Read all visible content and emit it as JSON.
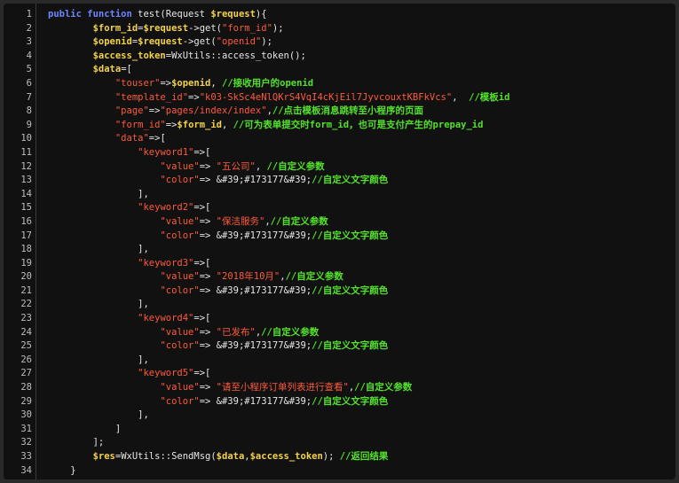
{
  "colors": {
    "background": "#111111",
    "keyword": "#6e86ff",
    "variable": "#f2d24b",
    "string": "#ff5a3c",
    "comment": "#54e12c",
    "default": "#e6e6e6",
    "line_number": "#bdbdbd"
  },
  "lines": [
    {
      "n": "1",
      "tokens": [
        {
          "t": "kw",
          "v": "public function"
        },
        {
          "t": "op",
          "v": " test(Request "
        },
        {
          "t": "var",
          "v": "$request"
        },
        {
          "t": "op",
          "v": "){"
        }
      ]
    },
    {
      "n": "2",
      "tokens": [
        {
          "t": "op",
          "v": "        "
        },
        {
          "t": "var",
          "v": "$form_id"
        },
        {
          "t": "op",
          "v": "="
        },
        {
          "t": "var",
          "v": "$request"
        },
        {
          "t": "op",
          "v": "->get("
        },
        {
          "t": "str",
          "v": "\"form_id\""
        },
        {
          "t": "op",
          "v": ");"
        }
      ]
    },
    {
      "n": "3",
      "tokens": [
        {
          "t": "op",
          "v": "        "
        },
        {
          "t": "var",
          "v": "$openid"
        },
        {
          "t": "op",
          "v": "="
        },
        {
          "t": "var",
          "v": "$request"
        },
        {
          "t": "op",
          "v": "->get("
        },
        {
          "t": "str",
          "v": "\"openid\""
        },
        {
          "t": "op",
          "v": ");"
        }
      ]
    },
    {
      "n": "4",
      "tokens": [
        {
          "t": "op",
          "v": "        "
        },
        {
          "t": "var",
          "v": "$access_token"
        },
        {
          "t": "op",
          "v": "=WxUtils::access_token();"
        }
      ]
    },
    {
      "n": "5",
      "tokens": [
        {
          "t": "op",
          "v": "        "
        },
        {
          "t": "var",
          "v": "$data"
        },
        {
          "t": "op",
          "v": "=["
        }
      ]
    },
    {
      "n": "6",
      "tokens": [
        {
          "t": "op",
          "v": "            "
        },
        {
          "t": "str",
          "v": "\"touser\""
        },
        {
          "t": "op",
          "v": "=>"
        },
        {
          "t": "var",
          "v": "$openid"
        },
        {
          "t": "op",
          "v": ", "
        },
        {
          "t": "cm",
          "v": "//接收用户的openid"
        }
      ]
    },
    {
      "n": "7",
      "tokens": [
        {
          "t": "op",
          "v": "            "
        },
        {
          "t": "str",
          "v": "\"template_id\""
        },
        {
          "t": "op",
          "v": "=>"
        },
        {
          "t": "str",
          "v": "\"k03-SkSc4eNlQKrS4VqI4cKjEil7JyvcouxtKBFkVcs\""
        },
        {
          "t": "op",
          "v": ",  "
        },
        {
          "t": "cm",
          "v": "//模板id"
        }
      ]
    },
    {
      "n": "8",
      "tokens": [
        {
          "t": "op",
          "v": "            "
        },
        {
          "t": "str",
          "v": "\"page\""
        },
        {
          "t": "op",
          "v": "=>"
        },
        {
          "t": "str",
          "v": "\"pages/index/index\""
        },
        {
          "t": "op",
          "v": ","
        },
        {
          "t": "cm",
          "v": "//点击模板消息跳转至小程序的页面"
        }
      ]
    },
    {
      "n": "9",
      "tokens": [
        {
          "t": "op",
          "v": "            "
        },
        {
          "t": "str",
          "v": "\"form_id\""
        },
        {
          "t": "op",
          "v": "=>"
        },
        {
          "t": "var",
          "v": "$form_id"
        },
        {
          "t": "op",
          "v": ", "
        },
        {
          "t": "cm",
          "v": "//可为表单提交时form_id，也可是支付产生的prepay_id"
        }
      ]
    },
    {
      "n": "10",
      "tokens": [
        {
          "t": "op",
          "v": "            "
        },
        {
          "t": "str",
          "v": "\"data\""
        },
        {
          "t": "op",
          "v": "=>["
        }
      ]
    },
    {
      "n": "11",
      "tokens": [
        {
          "t": "op",
          "v": "                "
        },
        {
          "t": "str",
          "v": "\"keyword1\""
        },
        {
          "t": "op",
          "v": "=>["
        }
      ]
    },
    {
      "n": "12",
      "tokens": [
        {
          "t": "op",
          "v": "                    "
        },
        {
          "t": "str",
          "v": "\"value\""
        },
        {
          "t": "op",
          "v": "=> "
        },
        {
          "t": "str",
          "v": "\"五公司\""
        },
        {
          "t": "op",
          "v": ", "
        },
        {
          "t": "cm",
          "v": "//自定义参数"
        }
      ]
    },
    {
      "n": "13",
      "tokens": [
        {
          "t": "op",
          "v": "                    "
        },
        {
          "t": "str",
          "v": "\"color\""
        },
        {
          "t": "op",
          "v": "=> &#39;#173177&#39;"
        },
        {
          "t": "cm",
          "v": "//自定义文字颜色"
        }
      ]
    },
    {
      "n": "14",
      "tokens": [
        {
          "t": "op",
          "v": "                ],"
        }
      ]
    },
    {
      "n": "15",
      "tokens": [
        {
          "t": "op",
          "v": "                "
        },
        {
          "t": "str",
          "v": "\"keyword2\""
        },
        {
          "t": "op",
          "v": "=>["
        }
      ]
    },
    {
      "n": "16",
      "tokens": [
        {
          "t": "op",
          "v": "                    "
        },
        {
          "t": "str",
          "v": "\"value\""
        },
        {
          "t": "op",
          "v": "=> "
        },
        {
          "t": "str",
          "v": "\"保洁服务\""
        },
        {
          "t": "op",
          "v": ","
        },
        {
          "t": "cm",
          "v": "//自定义参数"
        }
      ]
    },
    {
      "n": "17",
      "tokens": [
        {
          "t": "op",
          "v": "                    "
        },
        {
          "t": "str",
          "v": "\"color\""
        },
        {
          "t": "op",
          "v": "=> &#39;#173177&#39;"
        },
        {
          "t": "cm",
          "v": "//自定义文字颜色"
        }
      ]
    },
    {
      "n": "18",
      "tokens": [
        {
          "t": "op",
          "v": "                ],"
        }
      ]
    },
    {
      "n": "19",
      "tokens": [
        {
          "t": "op",
          "v": "                "
        },
        {
          "t": "str",
          "v": "\"keyword3\""
        },
        {
          "t": "op",
          "v": "=>["
        }
      ]
    },
    {
      "n": "20",
      "tokens": [
        {
          "t": "op",
          "v": "                    "
        },
        {
          "t": "str",
          "v": "\"value\""
        },
        {
          "t": "op",
          "v": "=> "
        },
        {
          "t": "str",
          "v": "\"2018年10月\""
        },
        {
          "t": "op",
          "v": ","
        },
        {
          "t": "cm",
          "v": "//自定义参数"
        }
      ]
    },
    {
      "n": "21",
      "tokens": [
        {
          "t": "op",
          "v": "                    "
        },
        {
          "t": "str",
          "v": "\"color\""
        },
        {
          "t": "op",
          "v": "=> &#39;#173177&#39;"
        },
        {
          "t": "cm",
          "v": "//自定义文字颜色"
        }
      ]
    },
    {
      "n": "22",
      "tokens": [
        {
          "t": "op",
          "v": "                ],"
        }
      ]
    },
    {
      "n": "23",
      "tokens": [
        {
          "t": "op",
          "v": "                "
        },
        {
          "t": "str",
          "v": "\"keyword4\""
        },
        {
          "t": "op",
          "v": "=>["
        }
      ]
    },
    {
      "n": "24",
      "tokens": [
        {
          "t": "op",
          "v": "                    "
        },
        {
          "t": "str",
          "v": "\"value\""
        },
        {
          "t": "op",
          "v": "=> "
        },
        {
          "t": "str",
          "v": "\"已发布\""
        },
        {
          "t": "op",
          "v": ","
        },
        {
          "t": "cm",
          "v": "//自定义参数"
        }
      ]
    },
    {
      "n": "25",
      "tokens": [
        {
          "t": "op",
          "v": "                    "
        },
        {
          "t": "str",
          "v": "\"color\""
        },
        {
          "t": "op",
          "v": "=> &#39;#173177&#39;"
        },
        {
          "t": "cm",
          "v": "//自定义文字颜色"
        }
      ]
    },
    {
      "n": "26",
      "tokens": [
        {
          "t": "op",
          "v": "                ],"
        }
      ]
    },
    {
      "n": "27",
      "tokens": [
        {
          "t": "op",
          "v": "                "
        },
        {
          "t": "str",
          "v": "\"keyword5\""
        },
        {
          "t": "op",
          "v": "=>["
        }
      ]
    },
    {
      "n": "28",
      "tokens": [
        {
          "t": "op",
          "v": "                    "
        },
        {
          "t": "str",
          "v": "\"value\""
        },
        {
          "t": "op",
          "v": "=> "
        },
        {
          "t": "str",
          "v": "\"请至小程序订单列表进行查看\""
        },
        {
          "t": "op",
          "v": ","
        },
        {
          "t": "cm",
          "v": "//自定义参数"
        }
      ]
    },
    {
      "n": "29",
      "tokens": [
        {
          "t": "op",
          "v": "                    "
        },
        {
          "t": "str",
          "v": "\"color\""
        },
        {
          "t": "op",
          "v": "=> &#39;#173177&#39;"
        },
        {
          "t": "cm",
          "v": "//自定义文字颜色"
        }
      ]
    },
    {
      "n": "30",
      "tokens": [
        {
          "t": "op",
          "v": "                ],"
        }
      ]
    },
    {
      "n": "31",
      "tokens": [
        {
          "t": "op",
          "v": "            ]"
        }
      ]
    },
    {
      "n": "32",
      "tokens": [
        {
          "t": "op",
          "v": "        ];"
        }
      ]
    },
    {
      "n": "33",
      "tokens": [
        {
          "t": "op",
          "v": "        "
        },
        {
          "t": "var",
          "v": "$res"
        },
        {
          "t": "op",
          "v": "=WxUtils::SendMsg("
        },
        {
          "t": "var",
          "v": "$data"
        },
        {
          "t": "op",
          "v": ","
        },
        {
          "t": "var",
          "v": "$access_token"
        },
        {
          "t": "op",
          "v": "); "
        },
        {
          "t": "cm",
          "v": "//返回结果"
        }
      ]
    },
    {
      "n": "34",
      "tokens": [
        {
          "t": "op",
          "v": "    }"
        }
      ]
    }
  ]
}
